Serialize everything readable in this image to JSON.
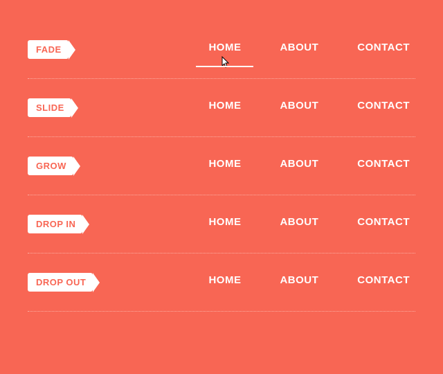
{
  "rows": [
    {
      "label": "FADE",
      "items": [
        "HOME",
        "ABOUT",
        "CONTACT"
      ],
      "active_index": 0,
      "show_cursor": true
    },
    {
      "label": "SLIDE",
      "items": [
        "HOME",
        "ABOUT",
        "CONTACT"
      ],
      "active_index": null,
      "show_cursor": false
    },
    {
      "label": "GROW",
      "items": [
        "HOME",
        "ABOUT",
        "CONTACT"
      ],
      "active_index": null,
      "show_cursor": false
    },
    {
      "label": "DROP IN",
      "items": [
        "HOME",
        "ABOUT",
        "CONTACT"
      ],
      "active_index": null,
      "show_cursor": false
    },
    {
      "label": "DROP OUT",
      "items": [
        "HOME",
        "ABOUT",
        "CONTACT"
      ],
      "active_index": null,
      "show_cursor": false
    }
  ]
}
